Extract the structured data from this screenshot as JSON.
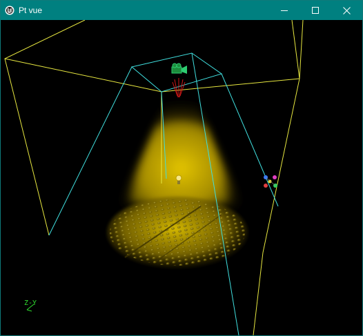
{
  "window": {
    "title": "Pt vue",
    "app_icon": "unreal-engine-icon",
    "controls": {
      "minimize_icon": "minimize-icon",
      "maximize_icon": "maximize-icon",
      "close_icon": "close-icon"
    },
    "titlebar_color": "#008080"
  },
  "viewport": {
    "background": "#000000",
    "axis_indicator": {
      "icon": "axis-gizmo-icon",
      "label": "Z-Y"
    },
    "objects": {
      "spotlight": {
        "icon": "spotlight-icon",
        "color": "#e8d000"
      },
      "camera": {
        "icon": "camera-icon",
        "color": "#2ecc71"
      },
      "point_marker": {
        "icon": "light-bulb-icon"
      },
      "gizmo": {
        "icon": "colored-dots-gizmo-icon"
      },
      "yellow_frustum": {
        "color": "#e8e840"
      },
      "cyan_frustum": {
        "color": "#40e0e0"
      }
    }
  }
}
